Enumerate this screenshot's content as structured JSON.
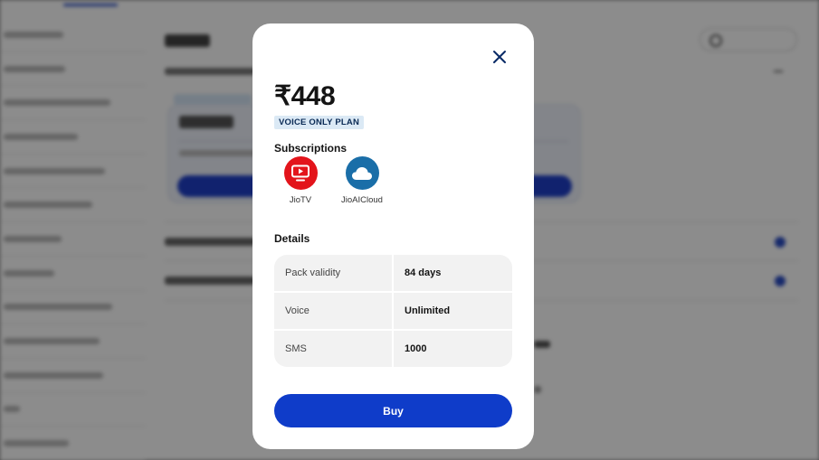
{
  "modal": {
    "price": "₹448",
    "plan_badge": "VOICE ONLY PLAN",
    "subscriptions_title": "Subscriptions",
    "subscriptions": [
      {
        "label": "JioTV",
        "icon": "jiotv-icon",
        "color": "#e3141b"
      },
      {
        "label": "JioAICloud",
        "icon": "jioaicloud-icon",
        "color": "#1a6ea8"
      }
    ],
    "details_title": "Details",
    "details": [
      {
        "label": "Pack validity",
        "value": "84 days"
      },
      {
        "label": "Voice",
        "value": "Unlimited"
      },
      {
        "label": "SMS",
        "value": "1000"
      }
    ],
    "buy_label": "Buy"
  },
  "colors": {
    "accent": "#0f3cc9",
    "badge_bg": "#dbe9f5",
    "row_bg": "#f2f2f2"
  }
}
